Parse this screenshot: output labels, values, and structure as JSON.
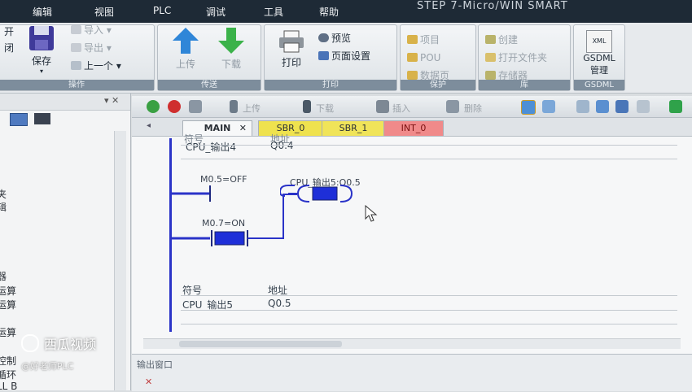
{
  "app_title": "STEP 7-Micro/WIN SMART",
  "menu": [
    "编辑",
    "视图",
    "PLC",
    "调试",
    "工具",
    "帮助"
  ],
  "ribbon": {
    "file_group": {
      "open_fragment": "开",
      "close_fragment": "闭",
      "save": "保存",
      "import": "导入",
      "export": "导出",
      "previous": "上一个",
      "label": "操作"
    },
    "transfer_group": {
      "upload": "上传",
      "download": "下载",
      "label": "传送"
    },
    "print_group": {
      "print": "打印",
      "preview": "预览",
      "page_setup": "页面设置",
      "label": "打印"
    },
    "protect_group": {
      "project": "项目",
      "pou": "POU",
      "data_page": "数据页",
      "label": "保护"
    },
    "library_group": {
      "create": "创建",
      "open_folder": "打开文件夹",
      "memory": "存储器",
      "label": "库"
    },
    "gsdml_group": {
      "xml": "XML",
      "manage_line1": "GSDML",
      "manage_line2": "管理",
      "label": "GSDML"
    }
  },
  "left_panel": {
    "tree_fragments": [
      "夹",
      "辑",
      "器",
      "运算",
      "运算",
      "运算",
      "控制",
      "循环",
      "LL B"
    ]
  },
  "editor": {
    "toolbar": {
      "upload": "上传",
      "download": "下载",
      "insert": "插入",
      "delete": "删除"
    },
    "tabs": [
      "MAIN",
      "SBR_0",
      "SBR_1",
      "INT_0"
    ],
    "top_table": {
      "header_symbol": "符号",
      "header_address": "地址",
      "symbol": "CPU_输出4",
      "address": "Q0.4"
    },
    "network": {
      "contact1": "M0.5=OFF",
      "coil": "CPU_输出5:Q0.5",
      "contact2": "M0.7=ON"
    },
    "bottom_table": {
      "header_symbol": "符号",
      "header_address": "地址",
      "symbol": "CPU_输出5",
      "address": "Q0.5"
    }
  },
  "output_window": {
    "title": "输出窗口"
  },
  "watermark": {
    "brand": "西瓜视频",
    "author": "@好老师PLC"
  }
}
